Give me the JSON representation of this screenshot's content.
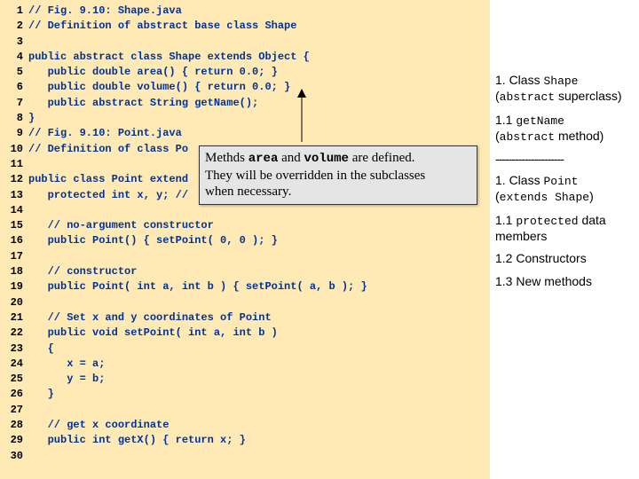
{
  "code": {
    "l1": "// Fig. 9.10: Shape.java",
    "l2": "// Definition of abstract base class Shape",
    "l3": "",
    "l4": "public abstract class Shape extends Object {",
    "l5": "   public double area() { return 0.0; }",
    "l6": "   public double volume() { return 0.0; }",
    "l7": "   public abstract String getName();",
    "l8": "}",
    "l9": "// Fig. 9.10: Point.java",
    "l10": "// Definition of class Po",
    "l11": "",
    "l12": "public class Point extend",
    "l13": "   protected int x, y; //",
    "l14": "",
    "l15": "   // no-argument constructor",
    "l16": "   public Point() { setPoint( 0, 0 ); }",
    "l17": "",
    "l18": "   // constructor",
    "l19": "   public Point( int a, int b ) { setPoint( a, b ); }",
    "l20": "",
    "l21": "   // Set x and y coordinates of Point",
    "l22": "   public void setPoint( int a, int b )",
    "l23": "   {",
    "l24": "      x = a;",
    "l25": "      y = b;",
    "l26": "   }",
    "l27": "",
    "l28": "   // get x coordinate",
    "l29": "   public int getX() { return x; }",
    "l30": ""
  },
  "callout": {
    "line1_a": "Methds ",
    "line1_b": "area",
    "line1_c": " and ",
    "line1_d": "volume",
    "line1_e": " are defined.",
    "line2": "They will be overridden in the subclasses",
    "line3": "when necessary."
  },
  "notes": {
    "n1a": "1. Class ",
    "n1b": "Shape",
    "n1c": "(",
    "n1d": "abstract",
    "n1e": " superclass)",
    "n2a": "1.1 ",
    "n2b": "getName",
    "n2c": "(",
    "n2d": "abstract",
    "n2e": " method)",
    "sep": "---------------------",
    "n3a": "1. Class ",
    "n3b": "Point",
    "n3c": "(",
    "n3d": "extends Shape",
    "n3e": ")",
    "n4a": "1.1 ",
    "n4b": "protected",
    "n4c": " data members",
    "n5": "1.2 Constructors",
    "n6": "1.3 New methods"
  }
}
